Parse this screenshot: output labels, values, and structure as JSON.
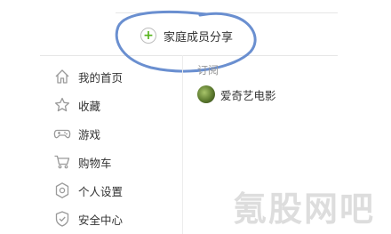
{
  "share": {
    "label": "家庭成员分享",
    "icon": "plus-circle-icon",
    "accent": "#54b31a"
  },
  "menu": {
    "items": [
      {
        "label": "我的首页",
        "icon": "home-icon"
      },
      {
        "label": "收藏",
        "icon": "star-icon"
      },
      {
        "label": "游戏",
        "icon": "gamepad-icon"
      },
      {
        "label": "购物车",
        "icon": "cart-icon"
      },
      {
        "label": "个人设置",
        "icon": "gear-icon"
      },
      {
        "label": "安全中心",
        "icon": "shield-icon"
      }
    ]
  },
  "subscriptions": {
    "title": "订阅",
    "items": [
      {
        "label": "爱奇艺电影",
        "icon": "avatar"
      }
    ]
  },
  "annotation": {
    "color": "#6a8fd0"
  },
  "watermark": {
    "text": "氪股网吧"
  }
}
